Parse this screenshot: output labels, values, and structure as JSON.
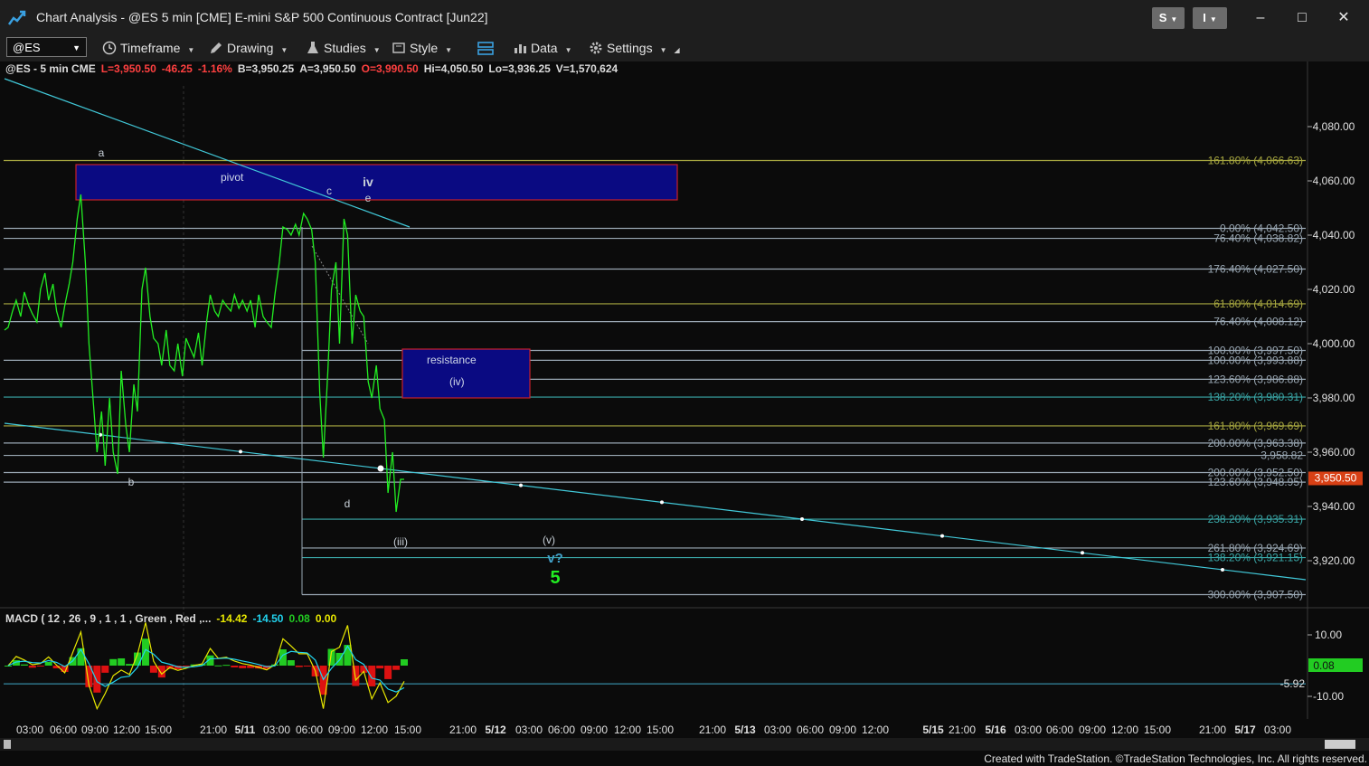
{
  "window": {
    "title": "Chart Analysis - @ES 5 min [CME] E-mini S&P 500 Continuous Contract [Jun22]",
    "btn_s": "S",
    "btn_i": "I",
    "minimize": "–",
    "maximize": "□",
    "close": "✕"
  },
  "toolbar": {
    "symbol": "@ES",
    "items": [
      "Timeframe",
      "Drawing",
      "Studies",
      "Style",
      "Data",
      "Settings"
    ]
  },
  "info": {
    "symbol_desc": "@ES - 5 min  CME",
    "last": "L=3,950.50",
    "change": "-46.25",
    "change_pct": "-1.16%",
    "bid": "B=3,950.25",
    "ask": "A=3,950.50",
    "open": "O=3,990.50",
    "high": "Hi=4,050.50",
    "low": "Lo=3,936.25",
    "volume": "V=1,570,624"
  },
  "macd_legend": {
    "label": "MACD ( 12 , 26 , 9 , 1 , 1 , Green , Red ,...",
    "v1": "-14.42",
    "v2": "-14.50",
    "v3": "0.08",
    "v4": "0.00"
  },
  "footer": "Created with TradeStation. ©TradeStation Technologies, Inc. All rights reserved.",
  "colors": {
    "price": "#22ee22",
    "trend": "#41c8d8",
    "box_fill": "#0a0a82",
    "box_border": "#c8202a",
    "macd_line": "#e8e800",
    "signal_line": "#22d3ee",
    "hist_pos": "#22cc22",
    "hist_neg": "#dd1111"
  },
  "chart_data": {
    "type": "line",
    "title": "",
    "ylim": [
      3900,
      4090
    ],
    "y_ticks": [
      "4,080.00",
      "4,060.00",
      "4,040.00",
      "4,020.00",
      "4,000.00",
      "3,980.00",
      "3,960.00",
      "3,940.00",
      "3,920.00"
    ],
    "y_tick_values": [
      4080,
      4060,
      4040,
      4020,
      4000,
      3980,
      3960,
      3940,
      3920
    ],
    "last_price_label": "3,950.50",
    "x_ticks": [
      "03:00",
      "06:00",
      "09:00",
      "12:00",
      "15:00",
      "21:00",
      "5/11",
      "03:00",
      "06:00",
      "09:00",
      "12:00",
      "15:00",
      "21:00",
      "5/12",
      "03:00",
      "06:00",
      "09:00",
      "12:00",
      "15:00",
      "21:00",
      "5/13",
      "03:00",
      "06:00",
      "09:00",
      "12:00",
      "5/15",
      "21:00",
      "5/16",
      "03:00",
      "06:00",
      "09:00",
      "12:00",
      "15:00",
      "21:00",
      "5/17",
      "03:00"
    ],
    "price_path": [
      [
        4005,
        4006
      ],
      [
        4012,
        4016
      ],
      [
        4010,
        4019
      ],
      [
        4014,
        4011
      ],
      [
        4008,
        4020
      ],
      [
        4026,
        4016
      ],
      [
        4022,
        4012
      ],
      [
        4006,
        4014
      ],
      [
        4022,
        4030
      ],
      [
        4046,
        4055
      ],
      [
        4030,
        4000
      ],
      [
        3978,
        3960
      ],
      [
        3975,
        3955
      ],
      [
        3980,
        3960
      ],
      [
        3952,
        3990
      ],
      [
        3970,
        3960
      ],
      [
        3985,
        3975
      ],
      [
        4020,
        4028
      ],
      [
        4010,
        4002
      ],
      [
        4000,
        3992
      ],
      [
        4005,
        3992
      ],
      [
        3990,
        4000
      ],
      [
        3988,
        4002
      ],
      [
        3998,
        3995
      ],
      [
        4004,
        3992
      ],
      [
        4008,
        4018
      ],
      [
        4012,
        4010
      ],
      [
        4016,
        4014
      ],
      [
        4012,
        4018
      ],
      [
        4013,
        4016
      ],
      [
        4012,
        4016
      ],
      [
        4006,
        4018
      ],
      [
        4010,
        4008
      ],
      [
        4006,
        4018
      ],
      [
        4030,
        4043
      ],
      [
        4042,
        4040
      ],
      [
        4044,
        4040
      ],
      [
        4048,
        4046
      ],
      [
        4042,
        4030
      ],
      [
        3982,
        3958
      ],
      [
        3990,
        4020
      ],
      [
        4030,
        4000
      ],
      [
        4046,
        4040
      ],
      [
        4000,
        4018
      ],
      [
        4012,
        4010
      ],
      [
        3986,
        3980
      ],
      [
        3992,
        3976
      ],
      [
        3972,
        3945
      ],
      [
        3960,
        3938
      ],
      [
        3950,
        3950
      ]
    ],
    "fib_levels": [
      {
        "label": "161.80% (4,066.63)",
        "value": 4067.5,
        "color": "#a8a840"
      },
      {
        "label": "0.00% (4,042.50)",
        "value": 4042.5,
        "color": "#9aa8b4"
      },
      {
        "label": "76.40% (4,038.82)",
        "value": 4038.82,
        "color": "#9aa8b4"
      },
      {
        "label": "176.40% (4,027.50)",
        "value": 4027.5,
        "color": "#9aa8b4"
      },
      {
        "label": "61.80% (4,014.69)",
        "value": 4014.69,
        "color": "#a8a840"
      },
      {
        "label": "76.40% (4,008.12)",
        "value": 4008.12,
        "color": "#9aa8b4"
      },
      {
        "label": "100.00% (3,997.50)",
        "value": 3997.5,
        "color": "#9aa8b4"
      },
      {
        "label": "100.00% (3,993.88)",
        "value": 3993.88,
        "color": "#9aa8b4"
      },
      {
        "label": "123.60% (3,986.88)",
        "value": 3986.88,
        "color": "#9aa8b4"
      },
      {
        "label": "138.20% (3,980.31)",
        "value": 3980.31,
        "color": "#3aa8a8"
      },
      {
        "label": "161.80% (3,969.69)",
        "value": 3969.69,
        "color": "#a8a840"
      },
      {
        "label": "200.00% (3,963.38)",
        "value": 3963.38,
        "color": "#9aa8b4"
      },
      {
        "label": "3,958.82",
        "value": 3958.82,
        "color": "#9aa8b4"
      },
      {
        "label": "200.00% (3,952.50)",
        "value": 3952.5,
        "color": "#9aa8b4"
      },
      {
        "label": "123.60% (3,948.95)",
        "value": 3948.95,
        "color": "#9aa8b4"
      },
      {
        "label": "238.20% (3,935.31)",
        "value": 3935.31,
        "color": "#3aa8a8"
      },
      {
        "label": "261.80% (3,924.69)",
        "value": 3924.69,
        "color": "#9aa8b4"
      },
      {
        "label": "138.20% (3,921.15)",
        "value": 3921.15,
        "color": "#3aa8a8"
      },
      {
        "label": "300.00% (3,907.50)",
        "value": 3907.5,
        "color": "#9aa8b4"
      }
    ],
    "boxes": [
      {
        "label": "pivot",
        "top": 4066,
        "bottom": 4053
      },
      {
        "label": "resistance",
        "sub": "(iv)",
        "top": 3998,
        "bottom": 3980
      }
    ],
    "wave_labels": [
      "a",
      "b",
      "c",
      "d",
      "e",
      "iv",
      "(iii)",
      "(v)",
      "v?",
      "5"
    ],
    "macd": {
      "ylim": [
        -15,
        15
      ],
      "y_ticks": [
        "10.00",
        "-10.00"
      ],
      "y_tick_values": [
        10,
        -10
      ],
      "last_value_label": "0.08",
      "level_label": "-5.92",
      "level_value": -5.92
    }
  }
}
